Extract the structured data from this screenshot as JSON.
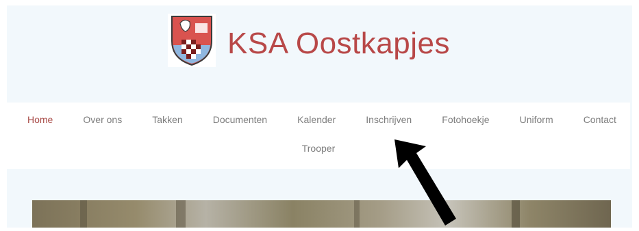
{
  "site": {
    "title": "KSA Oostkapjes",
    "logo_icon": "shield-crest-icon",
    "title_color": "#b84848"
  },
  "nav": {
    "items": [
      {
        "label": "Home",
        "active": true
      },
      {
        "label": "Over ons",
        "active": false
      },
      {
        "label": "Takken",
        "active": false
      },
      {
        "label": "Documenten",
        "active": false
      },
      {
        "label": "Kalender",
        "active": false
      },
      {
        "label": "Inschrijven",
        "active": false
      },
      {
        "label": "Fotohoekje",
        "active": false
      },
      {
        "label": "Uniform",
        "active": false
      },
      {
        "label": "Contact",
        "active": false
      },
      {
        "label": "Trooper",
        "active": false
      }
    ],
    "active_color": "#a84a46",
    "inactive_color": "#7d7d7d"
  },
  "overlay": {
    "icon": "arrow-pointer-icon"
  }
}
